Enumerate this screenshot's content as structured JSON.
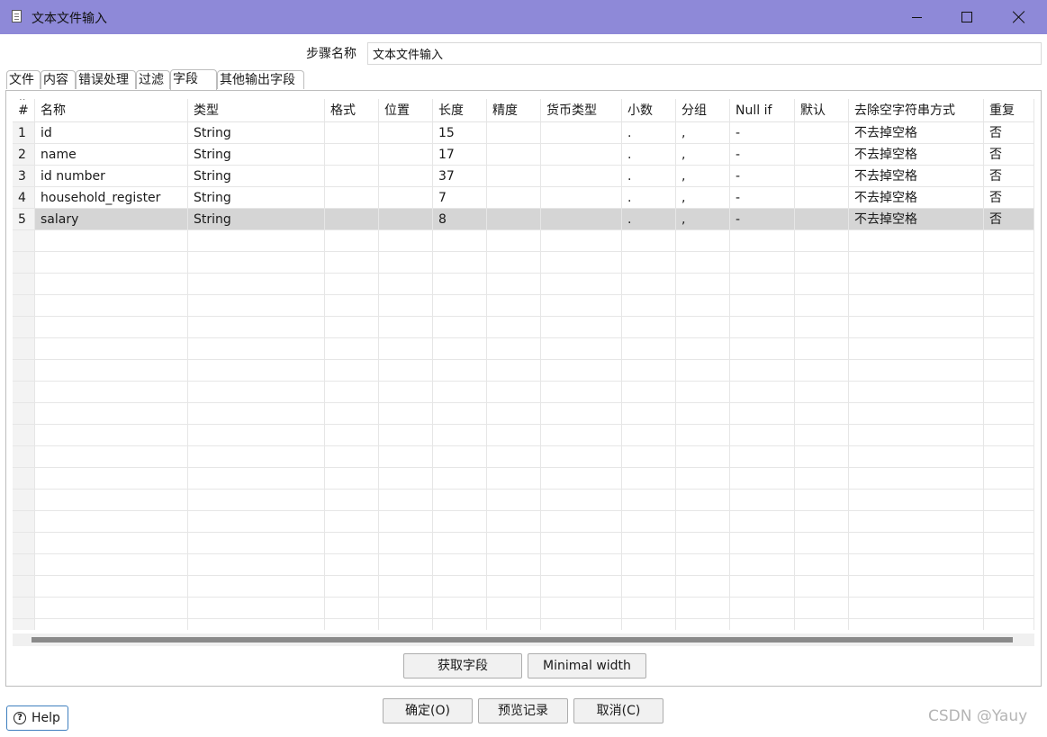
{
  "window": {
    "title": "文本文件输入",
    "title_bar_color": "#8e89d8"
  },
  "step": {
    "label": "步骤名称",
    "value": "文本文件输入"
  },
  "tabs": [
    {
      "label": "文件",
      "active": false
    },
    {
      "label": "内容",
      "active": false
    },
    {
      "label": "错误处理",
      "active": false
    },
    {
      "label": "过滤",
      "active": false
    },
    {
      "label": "字段",
      "active": true
    },
    {
      "label": "其他输出字段",
      "active": false
    }
  ],
  "table": {
    "sort_icon": "sort-up-icon",
    "columns": [
      "#",
      "名称",
      "类型",
      "格式",
      "位置",
      "长度",
      "精度",
      "货币类型",
      "小数",
      "分组",
      "Null if",
      "默认",
      "去除空字符串方式",
      "重复"
    ],
    "rows": [
      [
        "1",
        "id",
        "String",
        "",
        "",
        "15",
        "",
        "",
        ".",
        ",",
        "-",
        "",
        "不去掉空格",
        "否"
      ],
      [
        "2",
        "name",
        "String",
        "",
        "",
        "17",
        "",
        "",
        ".",
        ",",
        "-",
        "",
        "不去掉空格",
        "否"
      ],
      [
        "3",
        "id number",
        "String",
        "",
        "",
        "37",
        "",
        "",
        ".",
        ",",
        "-",
        "",
        "不去掉空格",
        "否"
      ],
      [
        "4",
        "household_register",
        "String",
        "",
        "",
        "7",
        "",
        "",
        ".",
        ",",
        "-",
        "",
        "不去掉空格",
        "否"
      ],
      [
        "5",
        "salary",
        "String",
        "",
        "",
        "8",
        "",
        "",
        ".",
        ",",
        "-",
        "",
        "不去掉空格",
        "否"
      ]
    ],
    "selected_row": 5,
    "selected_color": "#d5d5d5"
  },
  "buttons": {
    "get_fields": "获取字段",
    "minimal_width": "Minimal width",
    "ok": "确定(O)",
    "preview": "预览记录",
    "cancel": "取消(C)",
    "help": "Help"
  },
  "watermark": "CSDN @Yauy"
}
